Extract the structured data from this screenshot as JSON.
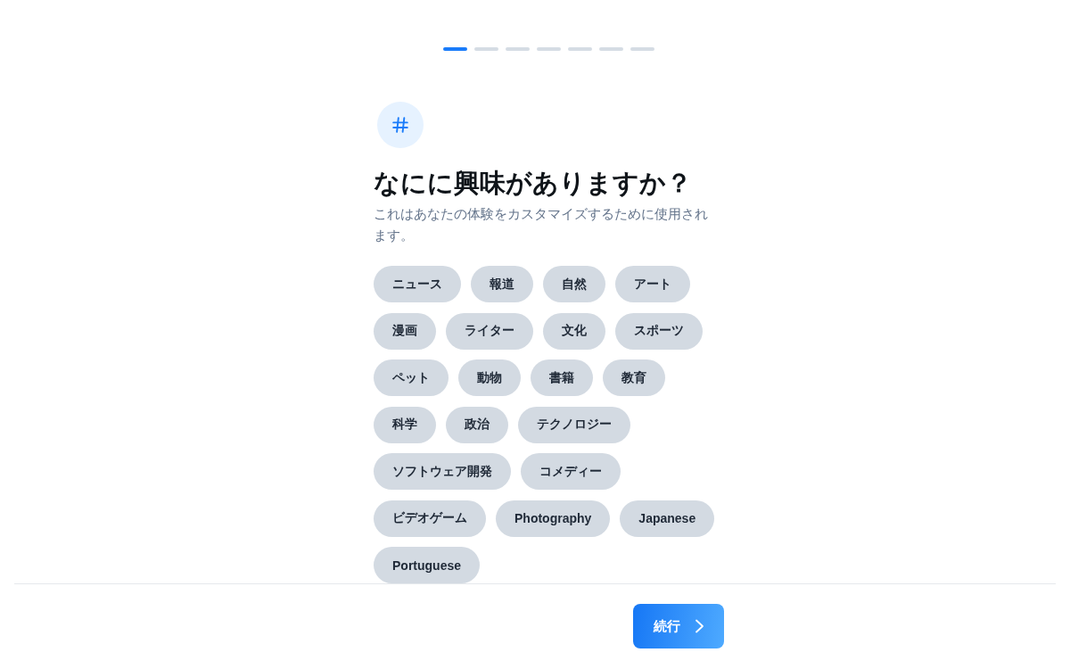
{
  "progress": {
    "steps": [
      {
        "current": true
      },
      {
        "current": false
      },
      {
        "current": false
      },
      {
        "current": false
      },
      {
        "current": false
      },
      {
        "current": false
      },
      {
        "current": false
      }
    ]
  },
  "title": "なにに興味がありますか？",
  "subtitle": "これはあなたの体験をカスタマイズするために使用されます。",
  "interests": [
    {
      "label": "ニュース",
      "selected": false
    },
    {
      "label": "報道",
      "selected": false
    },
    {
      "label": "自然",
      "selected": false
    },
    {
      "label": "アート",
      "selected": false
    },
    {
      "label": "漫画",
      "selected": false
    },
    {
      "label": "ライター",
      "selected": false
    },
    {
      "label": "文化",
      "selected": false
    },
    {
      "label": "スポーツ",
      "selected": false
    },
    {
      "label": "ペット",
      "selected": false
    },
    {
      "label": "動物",
      "selected": false
    },
    {
      "label": "書籍",
      "selected": false
    },
    {
      "label": "教育",
      "selected": false
    },
    {
      "label": "科学",
      "selected": false
    },
    {
      "label": "政治",
      "selected": false
    },
    {
      "label": "テクノロジー",
      "selected": false
    },
    {
      "label": "ソフトウェア開発",
      "selected": false
    },
    {
      "label": "コメディー",
      "selected": false
    },
    {
      "label": "ビデオゲーム",
      "selected": false
    },
    {
      "label": "Photography",
      "selected": false
    },
    {
      "label": "Japanese",
      "selected": false
    },
    {
      "label": "Portuguese",
      "selected": false
    }
  ],
  "continue_button": {
    "label": "続行"
  }
}
